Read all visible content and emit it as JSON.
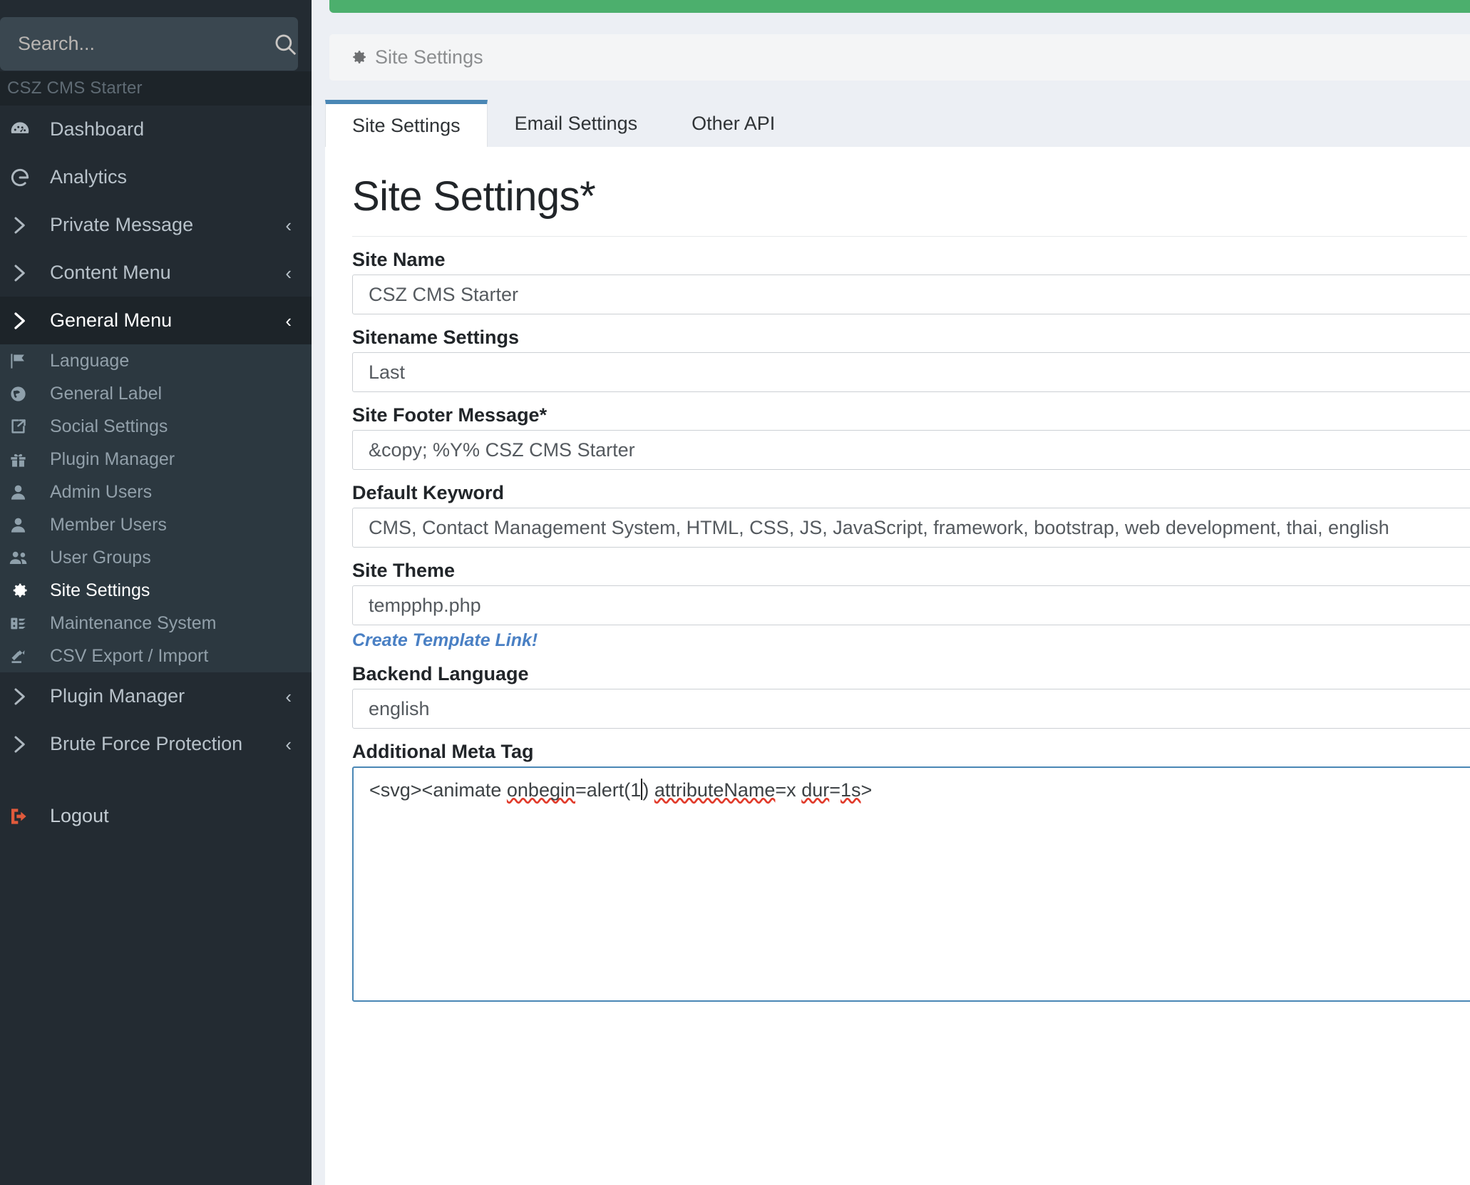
{
  "sidebar": {
    "search": {
      "placeholder": "Search...",
      "value": "",
      "icon": "search-icon"
    },
    "brand": "CSZ CMS Starter",
    "items": [
      {
        "label": "Dashboard",
        "icon": "dashboard-icon",
        "expandable": false,
        "active": false
      },
      {
        "label": "Analytics",
        "icon": "google-analytics-icon",
        "expandable": false,
        "active": false
      },
      {
        "label": "Private Message",
        "icon": "chevron-right-icon",
        "expandable": true,
        "active": false
      },
      {
        "label": "Content Menu",
        "icon": "chevron-right-icon",
        "expandable": true,
        "active": false
      },
      {
        "label": "General Menu",
        "icon": "chevron-right-icon",
        "expandable": true,
        "active": true
      }
    ],
    "submenu": [
      {
        "label": "Language",
        "icon": "flag-icon",
        "current": false
      },
      {
        "label": "General Label",
        "icon": "globe-icon",
        "current": false
      },
      {
        "label": "Social Settings",
        "icon": "share-icon",
        "current": false
      },
      {
        "label": "Plugin Manager",
        "icon": "gift-icon",
        "current": false
      },
      {
        "label": "Admin Users",
        "icon": "user-icon",
        "current": false
      },
      {
        "label": "Member Users",
        "icon": "user-icon",
        "current": false
      },
      {
        "label": "User Groups",
        "icon": "users-icon",
        "current": false
      },
      {
        "label": "Site Settings",
        "icon": "gear-icon",
        "current": true
      },
      {
        "label": "Maintenance System",
        "icon": "server-icon",
        "current": false
      },
      {
        "label": "CSV Export / Import",
        "icon": "file-export-icon",
        "current": false
      }
    ],
    "items_after": [
      {
        "label": "Plugin Manager",
        "icon": "chevron-right-icon",
        "expandable": true,
        "active": false
      },
      {
        "label": "Brute Force Protection",
        "icon": "chevron-right-icon",
        "expandable": true,
        "active": false
      }
    ],
    "logout": {
      "label": "Logout",
      "icon": "logout-icon"
    },
    "caret_glyph": "‹"
  },
  "breadcrumb": {
    "icon": "gear-icon",
    "label": "Site Settings"
  },
  "tabs": [
    {
      "label": "Site Settings",
      "active": true
    },
    {
      "label": "Email Settings",
      "active": false
    },
    {
      "label": "Other API",
      "active": false
    }
  ],
  "page": {
    "title": "Site Settings*"
  },
  "form": {
    "fields": [
      {
        "label": "Site Name",
        "value": "CSZ CMS Starter",
        "type": "text"
      },
      {
        "label": "Sitename Settings",
        "value": "Last",
        "type": "text"
      },
      {
        "label": "Site Footer Message*",
        "value": "&copy; %Y% CSZ CMS Starter",
        "type": "text"
      },
      {
        "label": "Default Keyword",
        "value": "CMS, Contact Management System, HTML, CSS, JS, JavaScript, framework, bootstrap, web development, thai, english",
        "type": "text"
      },
      {
        "label": "Site Theme",
        "value": "tempphp.php",
        "type": "text"
      },
      {
        "label": "Backend Language",
        "value": "english",
        "type": "text"
      },
      {
        "label": "Additional Meta Tag",
        "value": "<svg><animate onbegin=alert(1) attributeName=x dur=1s>",
        "type": "textarea"
      }
    ],
    "template_link": "Create Template Link!",
    "meta_tag_parts": {
      "p1": "<svg><animate ",
      "p2": "onbegin",
      "p3": "=alert(1",
      "p4": ") ",
      "p5": "attributeName",
      "p6": "=x ",
      "p7": "dur",
      "p8": "=",
      "p9": "1s",
      "p10": ">"
    }
  },
  "colors": {
    "sidebar_bg": "#232b32",
    "sidebar_sub_bg": "#2c3840",
    "sidebar_active_bg": "#1d2429",
    "top_accent": "#4caf6d",
    "tab_accent": "#4a87b5",
    "link": "#4a80c4",
    "logout": "#e05a3c",
    "content_bg": "#eceff4"
  }
}
